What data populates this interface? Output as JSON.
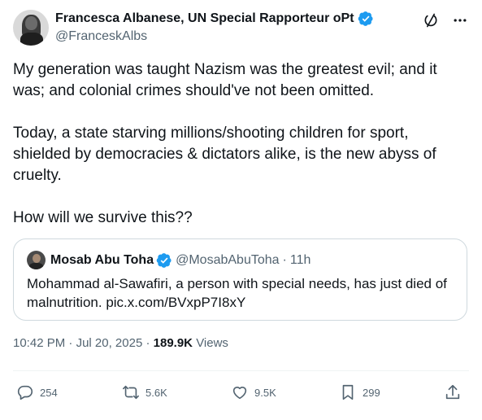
{
  "author": {
    "display_name": "Francesca Albanese, UN Special Rapporteur oPt",
    "handle": "@FranceskAlbs",
    "verified": true
  },
  "post": {
    "paragraphs": [
      "My generation was taught Nazism was the greatest evil; and it was; and colonial crimes should've not been omitted.",
      "Today, a state starving millions/shooting children for sport, shielded by democracies & dictators alike, is the new abyss of cruelty.",
      "How will we survive this??"
    ]
  },
  "quoted_post": {
    "display_name": "Mosab Abu Toha",
    "handle": "@MosabAbuToha",
    "separator": "·",
    "time_ago": "11h",
    "verified": true,
    "text": "Mohammad al-Sawafiri, a person with special needs, has just died of malnutrition. pic.x.com/BVxpP7I8xY"
  },
  "meta": {
    "time": "10:42 PM",
    "separator": "·",
    "date": "Jul 20, 2025",
    "separator2": "·",
    "views_count": "189.9K",
    "views_label": "Views"
  },
  "actions": {
    "reply_count": "254",
    "repost_count": "5.6K",
    "like_count": "9.5K",
    "bookmark_count": "299"
  },
  "icons": {
    "top": [
      "grok-icon",
      "more-icon"
    ],
    "verified_color": "#1d9bf0"
  },
  "colors": {
    "text": "#0f1419",
    "secondary": "#536471",
    "border": "#cfd9de",
    "accent": "#1d9bf0"
  }
}
